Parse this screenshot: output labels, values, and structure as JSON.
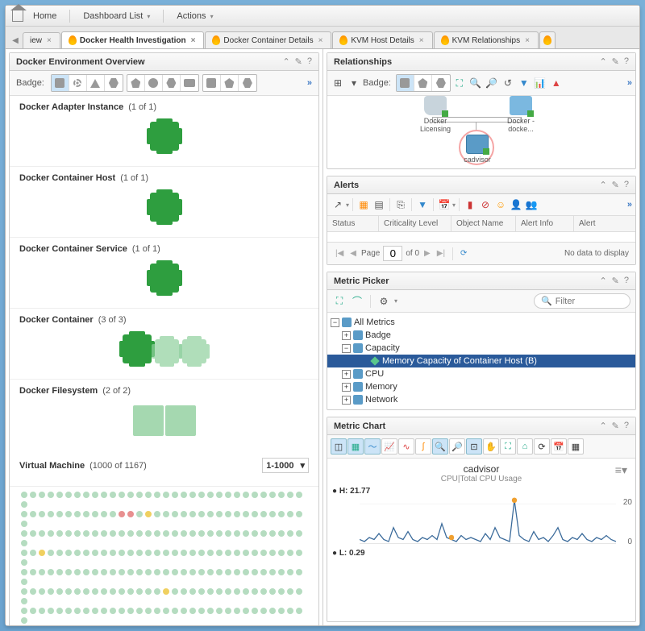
{
  "menubar": {
    "home": "Home",
    "dashboard_list": "Dashboard List",
    "actions": "Actions"
  },
  "tabs": {
    "partial_left": "iew",
    "items": [
      {
        "label": "Docker Health Investigation",
        "active": true
      },
      {
        "label": "Docker Container Details",
        "active": false
      },
      {
        "label": "KVM Host Details",
        "active": false
      },
      {
        "label": "KVM Relationships",
        "active": false
      }
    ]
  },
  "panels": {
    "env": {
      "title": "Docker Environment Overview",
      "badge_label": "Badge:",
      "sections": [
        {
          "name": "Docker Adapter Instance",
          "count": "(1 of 1)",
          "blocks": 1,
          "variant": "solid"
        },
        {
          "name": "Docker Container Host",
          "count": "(1 of 1)",
          "blocks": 1,
          "variant": "solid"
        },
        {
          "name": "Docker Container Service",
          "count": "(1 of 1)",
          "blocks": 1,
          "variant": "solid"
        },
        {
          "name": "Docker Container",
          "count": "(3 of 3)",
          "blocks": 3,
          "variant": "mixed"
        },
        {
          "name": "Docker Filesystem",
          "count": "(2 of 2)",
          "blocks": 2,
          "variant": "fs"
        }
      ],
      "vm": {
        "name": "Virtual Machine",
        "count": "(1000 of 1167)",
        "range": "1-1000"
      }
    },
    "relationships": {
      "title": "Relationships",
      "badge_label": "Badge:",
      "nodes": {
        "licensing": "Docker Licensing",
        "docker": "Docker - docke...",
        "cadvisor": "cadvisor"
      }
    },
    "alerts": {
      "title": "Alerts",
      "columns": [
        "Status",
        "Criticality Level",
        "Object Name",
        "Alert Info",
        "Alert"
      ],
      "pager": {
        "page_label": "Page",
        "page": "0",
        "of": "of 0",
        "nodata": "No data to display"
      }
    },
    "metric_picker": {
      "title": "Metric Picker",
      "filter_placeholder": "Filter",
      "tree": {
        "root": "All Metrics",
        "badge": "Badge",
        "capacity": "Capacity",
        "capacity_child": "Memory Capacity of Container Host (B)",
        "cpu": "CPU",
        "memory": "Memory",
        "network": "Network"
      }
    },
    "metric_chart": {
      "title": "Metric Chart",
      "object": "cadvisor",
      "metric": "CPU|Total CPU Usage",
      "high_label": "H: 21.77",
      "low_label": "L: 0.29",
      "axis": {
        "top": "20",
        "bottom": "0"
      }
    }
  },
  "chart_data": {
    "type": "line",
    "title": "cadvisor",
    "subtitle": "CPU|Total CPU Usage",
    "ylabel": "",
    "ylim": [
      0,
      25
    ],
    "high": 21.77,
    "low": 0.29,
    "series": [
      {
        "name": "CPU|Total CPU Usage",
        "values": [
          2,
          1,
          3,
          2,
          5,
          2,
          1,
          8,
          3,
          2,
          6,
          2,
          1,
          3,
          2,
          4,
          2,
          10,
          3,
          2,
          1,
          4,
          2,
          3,
          2,
          1,
          5,
          2,
          8,
          3,
          2,
          1,
          21.77,
          4,
          2,
          1,
          6,
          2,
          3,
          1,
          4,
          8,
          2,
          1,
          3,
          2,
          5,
          2,
          1,
          3,
          2,
          4,
          2,
          1
        ]
      }
    ],
    "markers": [
      {
        "index": 32,
        "value": 21.77
      },
      {
        "index": 19,
        "value": 3
      }
    ]
  }
}
